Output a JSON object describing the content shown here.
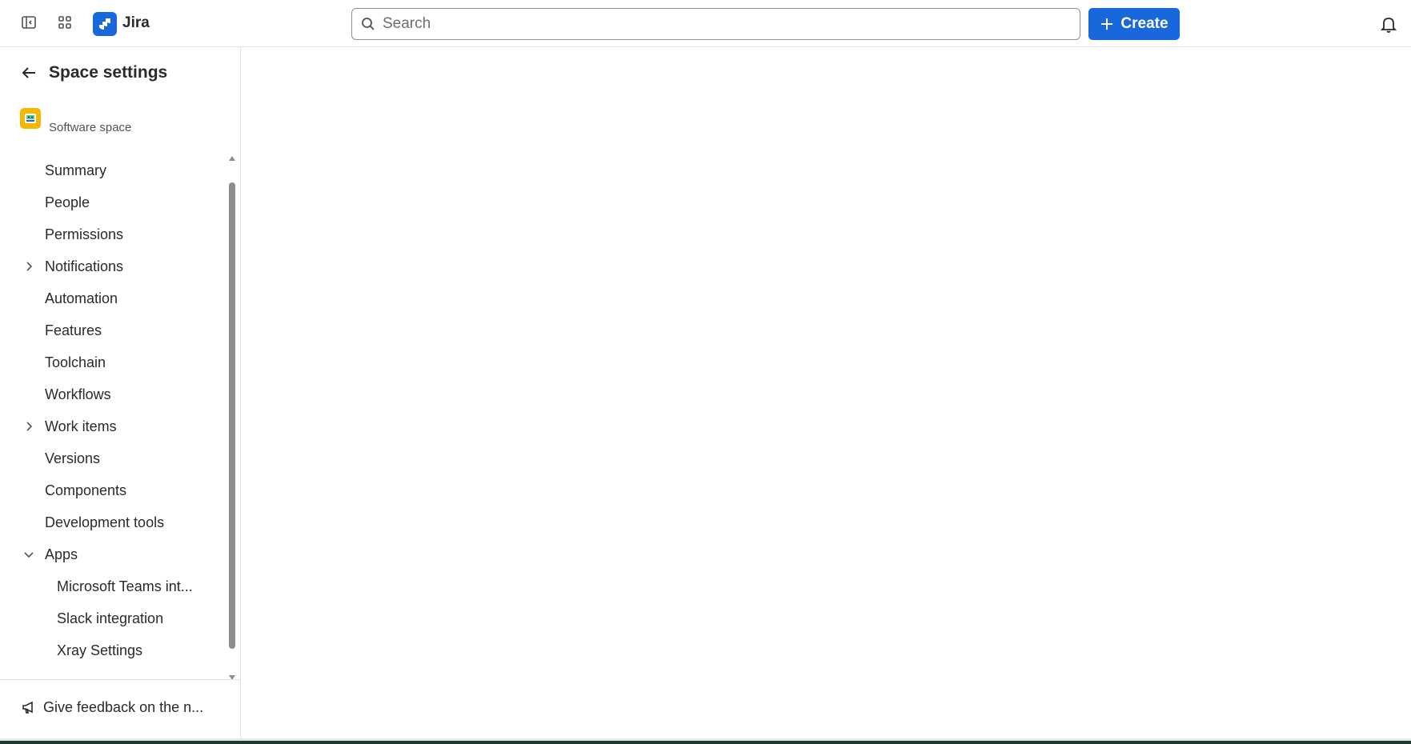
{
  "topbar": {
    "app_name": "Jira",
    "search_placeholder": "Search",
    "create_label": "Create",
    "icons": {
      "sidebar_toggle": "sidebar-toggle-icon",
      "app_switcher": "app-switcher-icon",
      "logo": "jira-logo-icon",
      "search": "search-icon",
      "create": "plus-icon",
      "notifications": "bell-icon"
    },
    "accent_color": "#1868db"
  },
  "sidebar": {
    "title": "Space settings",
    "space_type": "Software space",
    "items": [
      {
        "label": "Summary",
        "expandable": false
      },
      {
        "label": "People",
        "expandable": false
      },
      {
        "label": "Permissions",
        "expandable": false
      },
      {
        "label": "Notifications",
        "expandable": true,
        "expanded": false
      },
      {
        "label": "Automation",
        "expandable": false
      },
      {
        "label": "Features",
        "expandable": false
      },
      {
        "label": "Toolchain",
        "expandable": false
      },
      {
        "label": "Workflows",
        "expandable": false
      },
      {
        "label": "Work items",
        "expandable": true,
        "expanded": false
      },
      {
        "label": "Versions",
        "expandable": false
      },
      {
        "label": "Components",
        "expandable": false
      },
      {
        "label": "Development tools",
        "expandable": false
      },
      {
        "label": "Apps",
        "expandable": true,
        "expanded": true
      },
      {
        "label": "Microsoft Teams int...",
        "sub": true
      },
      {
        "label": "Slack integration",
        "sub": true
      },
      {
        "label": "Xray Settings",
        "sub": true
      }
    ],
    "feedback_label": "Give feedback on the n..."
  }
}
